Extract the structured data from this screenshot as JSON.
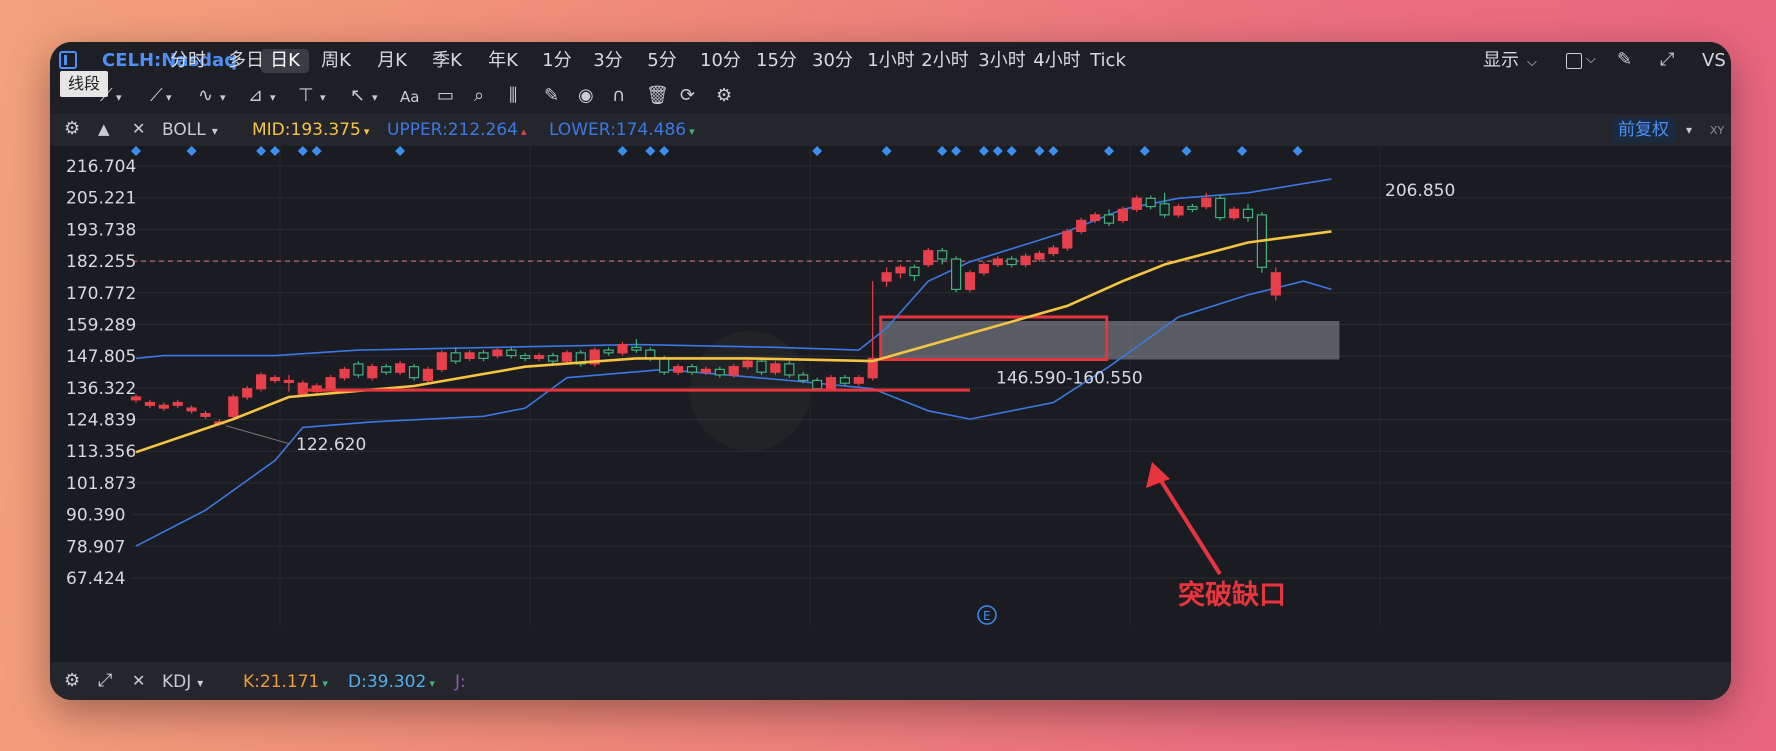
{
  "app": {
    "symbol": "CELH:Nasdaq"
  },
  "timeframes": [
    "分时",
    "多日",
    "日K",
    "周K",
    "月K",
    "季K",
    "年K",
    "1分",
    "3分",
    "5分",
    "10分",
    "15分",
    "30分",
    "1小时",
    "2小时",
    "3小时",
    "4小时",
    "Tick"
  ],
  "active_timeframe": "日K",
  "right_controls": {
    "display": "显示",
    "trailing": "VS"
  },
  "tooltip": "线段",
  "indicator": {
    "name": "BOLL",
    "mid": "MID:193.375",
    "upper": "UPPER:212.264",
    "lower": "LOWER:174.486",
    "adjust": "前复权"
  },
  "kdj": {
    "name": "KDJ",
    "k": "K:21.171",
    "d": "D:39.302",
    "j": "J:"
  },
  "colors": {
    "up": "#e8404a",
    "down": "#3fb27f",
    "mid": "#f4c443",
    "band": "#3a78e6",
    "annotation": "#e8353d",
    "marker": "#3a8ef0"
  },
  "chart_data": {
    "type": "candlestick",
    "y_ticks": [
      216.704,
      205.221,
      193.738,
      182.255,
      170.772,
      159.289,
      147.805,
      136.322,
      124.839,
      113.356,
      101.873,
      90.39,
      78.907,
      67.424
    ],
    "ylim": [
      67.424,
      216.704
    ],
    "y_tick_labels": [
      "216.704",
      "205.221",
      "193.738",
      "182.255",
      "170.772",
      "159.289",
      "147.805",
      "136.322",
      "124.839",
      "113.356",
      "101.873",
      "90.390",
      "78.907",
      "67.424"
    ],
    "candles": [
      [
        132,
        133,
        131,
        134
      ],
      [
        130,
        131,
        129,
        132
      ],
      [
        129,
        130,
        128,
        131
      ],
      [
        130,
        131,
        129,
        132
      ],
      [
        128,
        129,
        127,
        130
      ],
      [
        126,
        127,
        125,
        128
      ],
      [
        124,
        124,
        122.6,
        125
      ],
      [
        126,
        133,
        125,
        134
      ],
      [
        133,
        136,
        132,
        137
      ],
      [
        136,
        141,
        135,
        142
      ],
      [
        139,
        140,
        138,
        141
      ],
      [
        139,
        139,
        135,
        141
      ],
      [
        134,
        138,
        133,
        139
      ],
      [
        135,
        137,
        134,
        138
      ],
      [
        136,
        140,
        135,
        141
      ],
      [
        140,
        143,
        139,
        144
      ],
      [
        145,
        141,
        140,
        146
      ],
      [
        140,
        144,
        139,
        145
      ],
      [
        144,
        142,
        141,
        145
      ],
      [
        142,
        145,
        141,
        146
      ],
      [
        144,
        140,
        139,
        145
      ],
      [
        139,
        143,
        138,
        144
      ],
      [
        143,
        149,
        142,
        150
      ],
      [
        149,
        146,
        145,
        151
      ],
      [
        147,
        149,
        146,
        150
      ],
      [
        149,
        147,
        146,
        150
      ],
      [
        148,
        150,
        147,
        151
      ],
      [
        150,
        148,
        147,
        151
      ],
      [
        148,
        147,
        146,
        149
      ],
      [
        147,
        148,
        146,
        149
      ],
      [
        148,
        146,
        145,
        149
      ],
      [
        146,
        149,
        145,
        150
      ],
      [
        149,
        145,
        144,
        150
      ],
      [
        145,
        150,
        144,
        151
      ],
      [
        150,
        149,
        148,
        151
      ],
      [
        149,
        152,
        148,
        153
      ],
      [
        151,
        150,
        149,
        154
      ],
      [
        150,
        147,
        146,
        151
      ],
      [
        147,
        142,
        141,
        148
      ],
      [
        142,
        144,
        141,
        145
      ],
      [
        144,
        142,
        141,
        145
      ],
      [
        142,
        143,
        141,
        144
      ],
      [
        143,
        141,
        140,
        144
      ],
      [
        141,
        144,
        140,
        145
      ],
      [
        144,
        146,
        143,
        147
      ],
      [
        146,
        142,
        141,
        147
      ],
      [
        142,
        145,
        141,
        146
      ],
      [
        145,
        141,
        140,
        146
      ],
      [
        141,
        139,
        138,
        142
      ],
      [
        139,
        136,
        135,
        140
      ],
      [
        136,
        140,
        135,
        141
      ],
      [
        140,
        138,
        137,
        141
      ],
      [
        138,
        140,
        137,
        141
      ],
      [
        140,
        147,
        139,
        175
      ],
      [
        175,
        178,
        173,
        180
      ],
      [
        178,
        180,
        176,
        181
      ],
      [
        180,
        177,
        175,
        181
      ],
      [
        181,
        186,
        180,
        187
      ],
      [
        186,
        183,
        181,
        187
      ],
      [
        183,
        172,
        171,
        184
      ],
      [
        172,
        178,
        171,
        179
      ],
      [
        178,
        181,
        177,
        182
      ],
      [
        181,
        183,
        180,
        184
      ],
      [
        183,
        181,
        180,
        184
      ],
      [
        181,
        184,
        180,
        185
      ],
      [
        183,
        185,
        182,
        186
      ],
      [
        185,
        187,
        184,
        188
      ],
      [
        187,
        193,
        186,
        194
      ],
      [
        193,
        197,
        192,
        198
      ],
      [
        197,
        199,
        196,
        200
      ],
      [
        199,
        196,
        195,
        201
      ],
      [
        197,
        201,
        196,
        202
      ],
      [
        201,
        205,
        200,
        206
      ],
      [
        205,
        202,
        201,
        206
      ],
      [
        203,
        199,
        198,
        207
      ],
      [
        199,
        202,
        198,
        203
      ],
      [
        202,
        201,
        200,
        203
      ],
      [
        202,
        205,
        201,
        207
      ],
      [
        205,
        198,
        197,
        206
      ],
      [
        198,
        201,
        197,
        202
      ],
      [
        201,
        198,
        196.5,
        203
      ],
      [
        199,
        180,
        178,
        200
      ],
      [
        170,
        178,
        168,
        180
      ]
    ],
    "boll_mid": [
      {
        "x": 0,
        "y": 113
      },
      {
        "x": 7,
        "y": 125
      },
      {
        "x": 11,
        "y": 133
      },
      {
        "x": 20,
        "y": 137
      },
      {
        "x": 28,
        "y": 144
      },
      {
        "x": 36,
        "y": 147
      },
      {
        "x": 44,
        "y": 147
      },
      {
        "x": 53,
        "y": 146
      },
      {
        "x": 60,
        "y": 156
      },
      {
        "x": 67,
        "y": 166
      },
      {
        "x": 71,
        "y": 175
      },
      {
        "x": 74,
        "y": 181
      },
      {
        "x": 80,
        "y": 189
      },
      {
        "x": 86,
        "y": 193
      }
    ],
    "boll_upper": [
      {
        "x": 0,
        "y": 147
      },
      {
        "x": 2,
        "y": 148
      },
      {
        "x": 10,
        "y": 148
      },
      {
        "x": 16,
        "y": 150
      },
      {
        "x": 26,
        "y": 151
      },
      {
        "x": 36,
        "y": 152
      },
      {
        "x": 46,
        "y": 151
      },
      {
        "x": 52,
        "y": 150
      },
      {
        "x": 54,
        "y": 158
      },
      {
        "x": 57,
        "y": 175
      },
      {
        "x": 60,
        "y": 182
      },
      {
        "x": 67,
        "y": 193
      },
      {
        "x": 71,
        "y": 201
      },
      {
        "x": 75,
        "y": 205
      },
      {
        "x": 80,
        "y": 207
      },
      {
        "x": 86,
        "y": 212
      }
    ],
    "boll_lower": [
      {
        "x": 0,
        "y": 79
      },
      {
        "x": 5,
        "y": 92
      },
      {
        "x": 10,
        "y": 110
      },
      {
        "x": 12,
        "y": 122
      },
      {
        "x": 17,
        "y": 124
      },
      {
        "x": 25,
        "y": 126
      },
      {
        "x": 28,
        "y": 129
      },
      {
        "x": 31,
        "y": 140
      },
      {
        "x": 38,
        "y": 143
      },
      {
        "x": 47,
        "y": 139
      },
      {
        "x": 53,
        "y": 136
      },
      {
        "x": 57,
        "y": 128
      },
      {
        "x": 60,
        "y": 125
      },
      {
        "x": 66,
        "y": 131
      },
      {
        "x": 70,
        "y": 144
      },
      {
        "x": 75,
        "y": 162
      },
      {
        "x": 80,
        "y": 170
      },
      {
        "x": 84,
        "y": 175
      },
      {
        "x": 86,
        "y": 172
      }
    ],
    "labels": {
      "high": "206.850",
      "low": "122.620",
      "gap": "146.590-160.550",
      "annotation": "突破缺口",
      "event": "E"
    },
    "gap_zone": [
      146.59,
      160.55
    ],
    "support_level": 135.5,
    "dashed_price": 182.255,
    "signal_markers": [
      0,
      4,
      9,
      10,
      12,
      13,
      19,
      35,
      37,
      38,
      49,
      54,
      58,
      59,
      61,
      62,
      63,
      65,
      66,
      70,
      72,
      75,
      79,
      83
    ]
  }
}
